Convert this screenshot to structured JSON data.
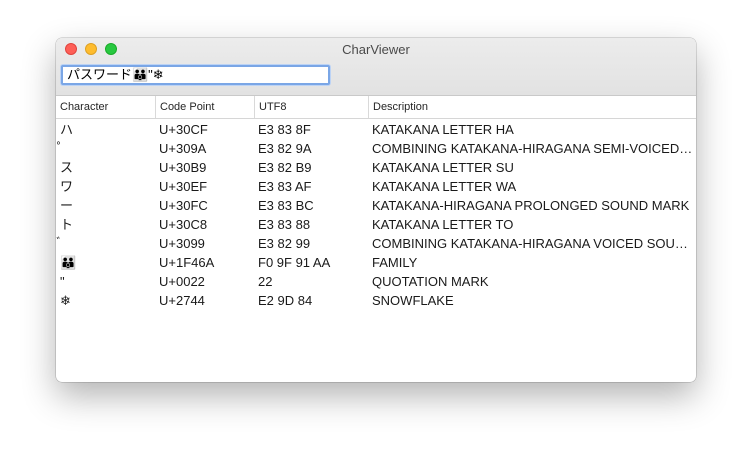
{
  "window": {
    "title": "CharViewer"
  },
  "search": {
    "value": "パスワード👪\"❄"
  },
  "table": {
    "columns": [
      "Character",
      "Code Point",
      "UTF8",
      "Description"
    ],
    "rows": [
      [
        "ハ",
        "U+30CF",
        "E3 83 8F",
        "KATAKANA LETTER HA"
      ],
      [
        "゚",
        "U+309A",
        "E3 82 9A",
        "COMBINING KATAKANA-HIRAGANA SEMI-VOICED SOUND MARK"
      ],
      [
        "ス",
        "U+30B9",
        "E3 82 B9",
        "KATAKANA LETTER SU"
      ],
      [
        "ワ",
        "U+30EF",
        "E3 83 AF",
        "KATAKANA LETTER WA"
      ],
      [
        "ー",
        "U+30FC",
        "E3 83 BC",
        "KATAKANA-HIRAGANA PROLONGED SOUND MARK"
      ],
      [
        "ト",
        "U+30C8",
        "E3 83 88",
        "KATAKANA LETTER TO"
      ],
      [
        "゙",
        "U+3099",
        "E3 82 99",
        "COMBINING KATAKANA-HIRAGANA VOICED SOUND MARK"
      ],
      [
        "👪",
        "U+1F46A",
        "F0 9F 91 AA",
        "FAMILY"
      ],
      [
        "\"",
        "U+0022",
        "22",
        "QUOTATION MARK"
      ],
      [
        "❄",
        "U+2744",
        "E2 9D 84",
        "SNOWFLAKE"
      ]
    ]
  }
}
